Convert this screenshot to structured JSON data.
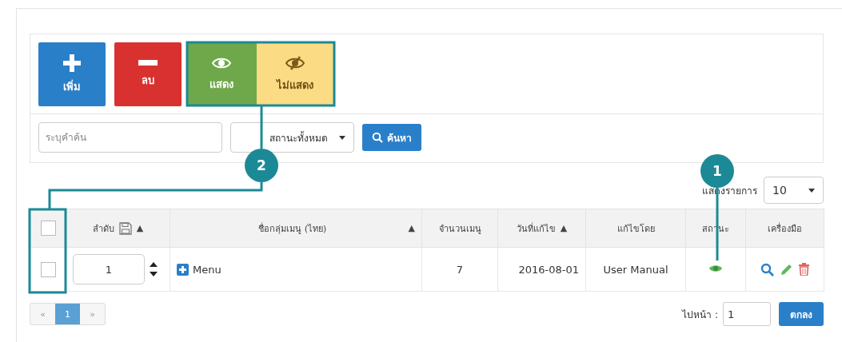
{
  "toolbar": {
    "buttons": [
      {
        "kind": "add",
        "label": "เพิ่ม"
      },
      {
        "kind": "delete",
        "label": "ลบ"
      },
      {
        "kind": "show",
        "label": "แสดง"
      },
      {
        "kind": "hide",
        "label": "ไม่แสดง"
      }
    ]
  },
  "search": {
    "placeholder": "ระบุคำค้น",
    "status_filter": "สถานะทั้งหมด",
    "button": "ค้นหา"
  },
  "page_size": {
    "label": "แสดงรายการ",
    "value": "10"
  },
  "table": {
    "columns": [
      {
        "kind": "check",
        "checked": false
      },
      {
        "kind": "order",
        "label": "ลำดับ",
        "sort_mark": "▲"
      },
      {
        "kind": "sort-spread",
        "label": "ชื่อกลุ่มเมนู (ไทย)",
        "sort_mark": "▲"
      },
      {
        "kind": "plain",
        "label": "จำนวนเมนู"
      },
      {
        "kind": "sort-inline",
        "label": "วันที่แก้ไข",
        "sort_mark": "▲"
      },
      {
        "kind": "plain",
        "label": "แก้ไขโดย"
      },
      {
        "kind": "plain",
        "label": "สถานะ"
      },
      {
        "kind": "plain",
        "label": "เครื่องมือ"
      }
    ],
    "rows": [
      {
        "checked": false,
        "order": "1",
        "name": "Menu",
        "count": "7",
        "modified": "2016-08-01",
        "modified_by": "User Manual",
        "visible": true
      }
    ]
  },
  "pager": {
    "pages": [
      {
        "label": "«",
        "selected": false
      },
      {
        "label": "1",
        "selected": true
      },
      {
        "label": "»",
        "selected": false
      }
    ],
    "goto_label": "ไปหน้า :",
    "goto_value": "1",
    "ok_button": "ตกลง"
  },
  "callouts": [
    {
      "number": "1"
    },
    {
      "number": "2"
    }
  ]
}
